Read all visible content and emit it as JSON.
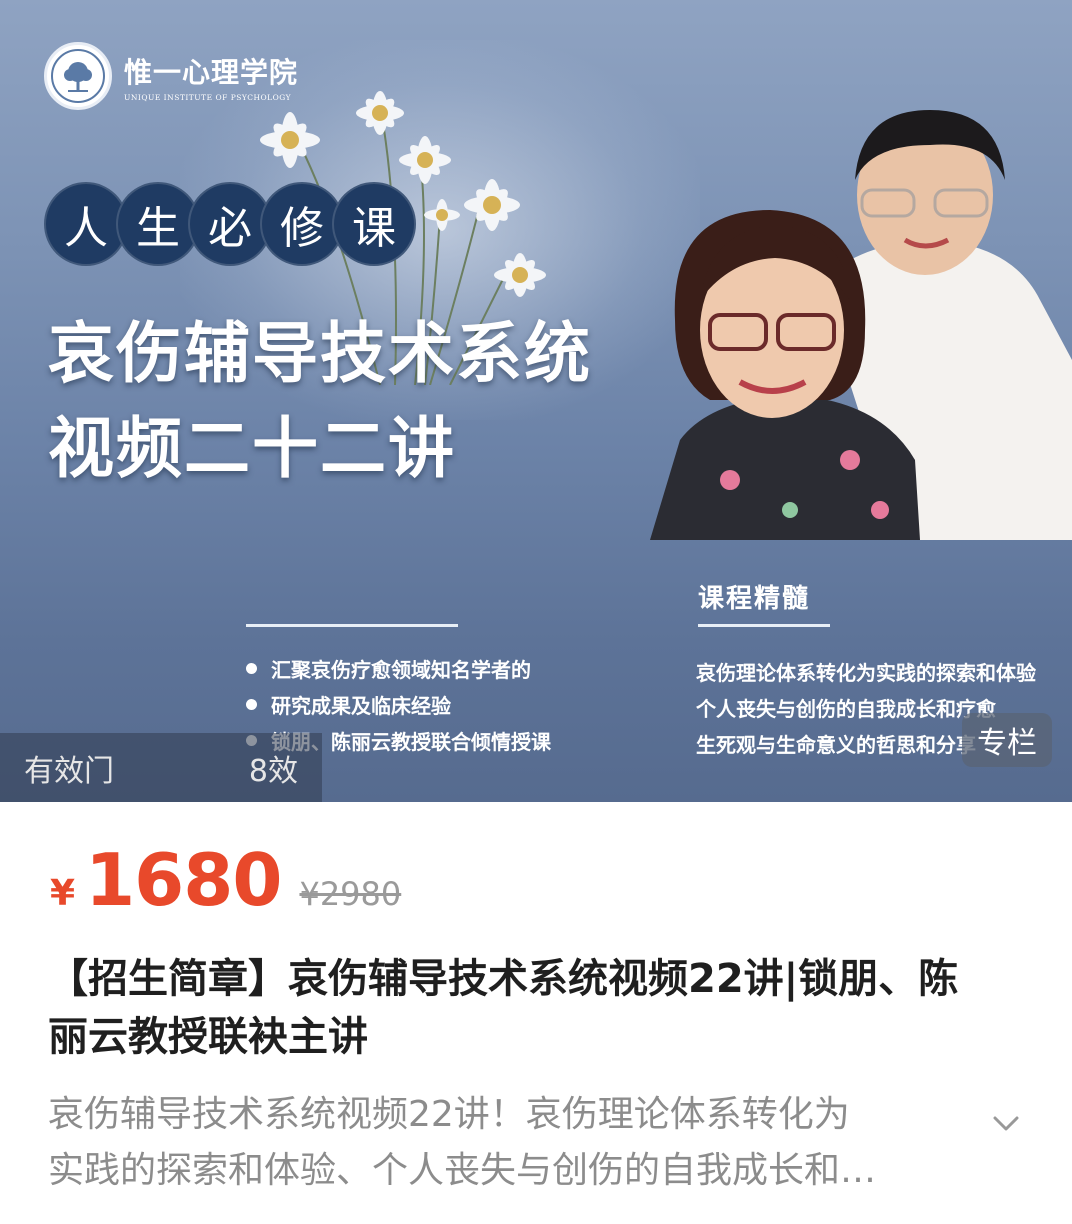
{
  "banner": {
    "logo": {
      "name": "惟一心理学院",
      "en": "UNIQUE INSTITUTE OF PSYCHOLOGY"
    },
    "pills": [
      "人",
      "生",
      "必",
      "修",
      "课"
    ],
    "headline": {
      "line1": "哀伤辅导技术系统",
      "line2": "视频二十二讲"
    },
    "bullets": [
      "汇聚哀伤疗愈领域知名学者的",
      "研究成果及临床经验",
      "锁朋、陈丽云教授联合倾情授课"
    ],
    "essence": {
      "title": "课程精髓",
      "items": [
        "哀伤理论体系转化为实践的探索和体验",
        "个人丧失与创伤的自我成长和疗愈",
        "生死观与生命意义的哲思和分享"
      ]
    },
    "watermark": {
      "left": "有效门",
      "right": "8效"
    },
    "badge": "专栏"
  },
  "price": {
    "symbol": "¥",
    "current": "1680",
    "original": "¥2980",
    "color": "#e8492b"
  },
  "title": "【招生简章】哀伤辅导技术系统视频22讲|锁朋、陈丽云教授联袂主讲",
  "description": {
    "line1": "哀伤辅导技术系统视频22讲！哀伤理论体系转化为",
    "line2": "实践的探索和体验、个人丧失与创伤的自我成长和…"
  },
  "icons": {
    "expand": "chevron-down-icon",
    "logo": "tree-logo-icon"
  }
}
